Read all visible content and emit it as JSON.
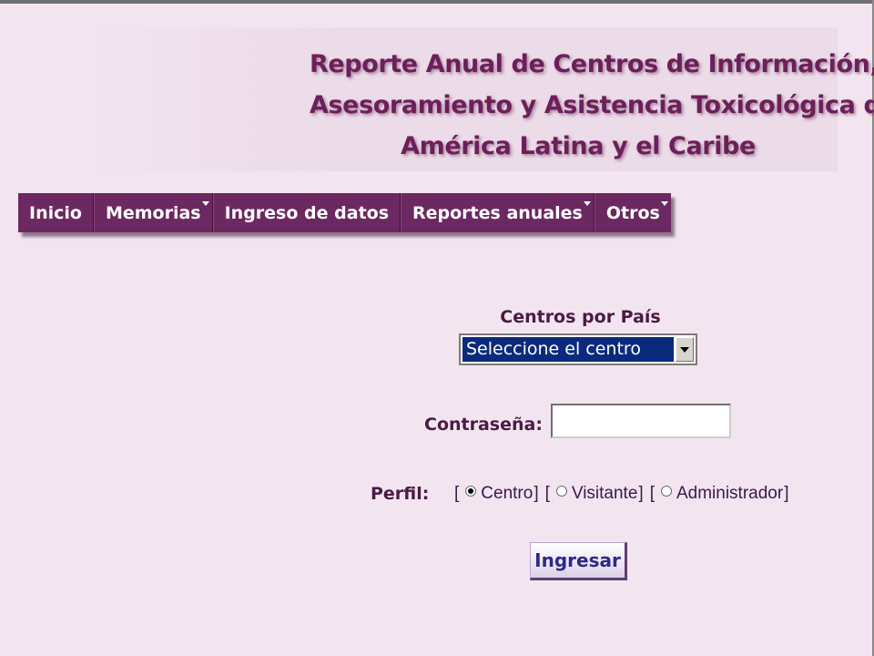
{
  "header": {
    "title_lines": [
      "Reporte Anual de Centros de Información,",
      "Asesoramiento y Asistencia Toxicológica de",
      "América Latina y el Caribe"
    ]
  },
  "menu": {
    "items": [
      {
        "label": "Inicio",
        "has_dropdown": false
      },
      {
        "label": "Memorias",
        "has_dropdown": true
      },
      {
        "label": "Ingreso de datos",
        "has_dropdown": false
      },
      {
        "label": "Reportes anuales",
        "has_dropdown": true
      },
      {
        "label": "Otros",
        "has_dropdown": true
      }
    ],
    "background_color": "#6c2860",
    "text_color": "#ffffff"
  },
  "form": {
    "centros_label": "Centros por País",
    "centro_select": {
      "selected": "Seleccione el centro",
      "icon": "dropdown-arrow-icon"
    },
    "password_label": "Contraseña:",
    "password_value": "",
    "perfil_label": "Perfil:",
    "perfil_options": [
      {
        "label": "Centro",
        "checked": true
      },
      {
        "label": "Visitante",
        "checked": false
      },
      {
        "label": "Administrador",
        "checked": false
      }
    ],
    "submit_label": "Ingresar"
  },
  "colors": {
    "page_background": "#f3e5f0",
    "title": "#6d1f5a",
    "label": "#4a1a44",
    "select_highlight": "#0c2a7c",
    "button_text": "#2a2a86"
  }
}
